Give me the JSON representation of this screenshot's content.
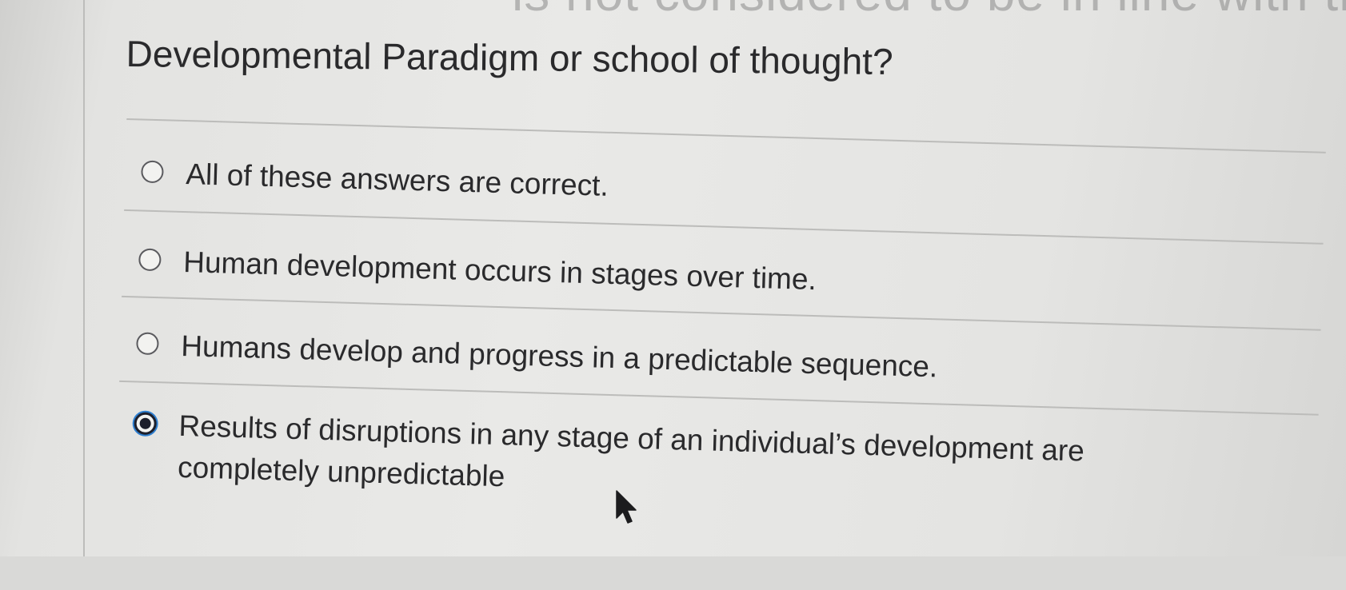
{
  "question": {
    "header_fragment": "is not considered to be in line with the",
    "text": "Developmental Paradigm or school of thought?"
  },
  "options": [
    {
      "label": "All of these answers are correct.",
      "selected": false
    },
    {
      "label": "Human development occurs in stages over time.",
      "selected": false
    },
    {
      "label": "Humans develop and progress in a predictable sequence.",
      "selected": false
    },
    {
      "label": "Results of disruptions in any stage of an individual’s development are completely unpredictable",
      "selected": true
    }
  ],
  "colors": {
    "text": "#2a2a2c",
    "radio_selected": "#1d1f2b",
    "focus_ring": "#2e7fd0",
    "divider": "#bcbcba"
  },
  "icons": {
    "cursor": "mouse-pointer-arrow-icon"
  }
}
